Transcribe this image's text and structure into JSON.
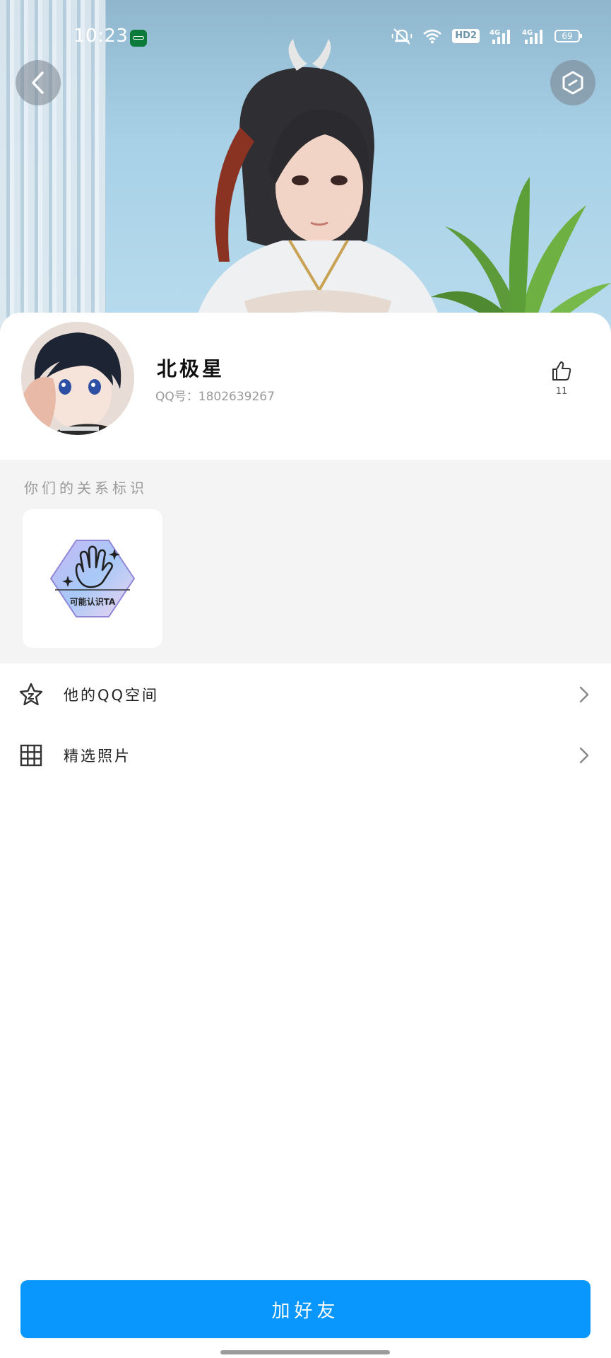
{
  "status_bar": {
    "time": "10:23",
    "hd_label": "HD2",
    "network_1": "4G",
    "network_2": "4G",
    "battery": "69"
  },
  "header": {
    "back_icon": "chevron-left-icon",
    "menu_icon": "hexagon-menu-icon"
  },
  "profile": {
    "nickname": "北极星",
    "qq_number": "QQ号：1802639267",
    "like_count": "11"
  },
  "relation": {
    "title": "你们的关系标识",
    "badge_label": "可能认识TA",
    "badge_colors": [
      "#c7b8f4",
      "#a7c9f7",
      "#f1d4f0"
    ]
  },
  "list": {
    "zone_label": "他的QQ空间",
    "photos_label": "精选照片"
  },
  "actions": {
    "add_friend": "加好友"
  },
  "colors": {
    "accent": "#0997fd",
    "section_bg": "#f4f4f4"
  }
}
